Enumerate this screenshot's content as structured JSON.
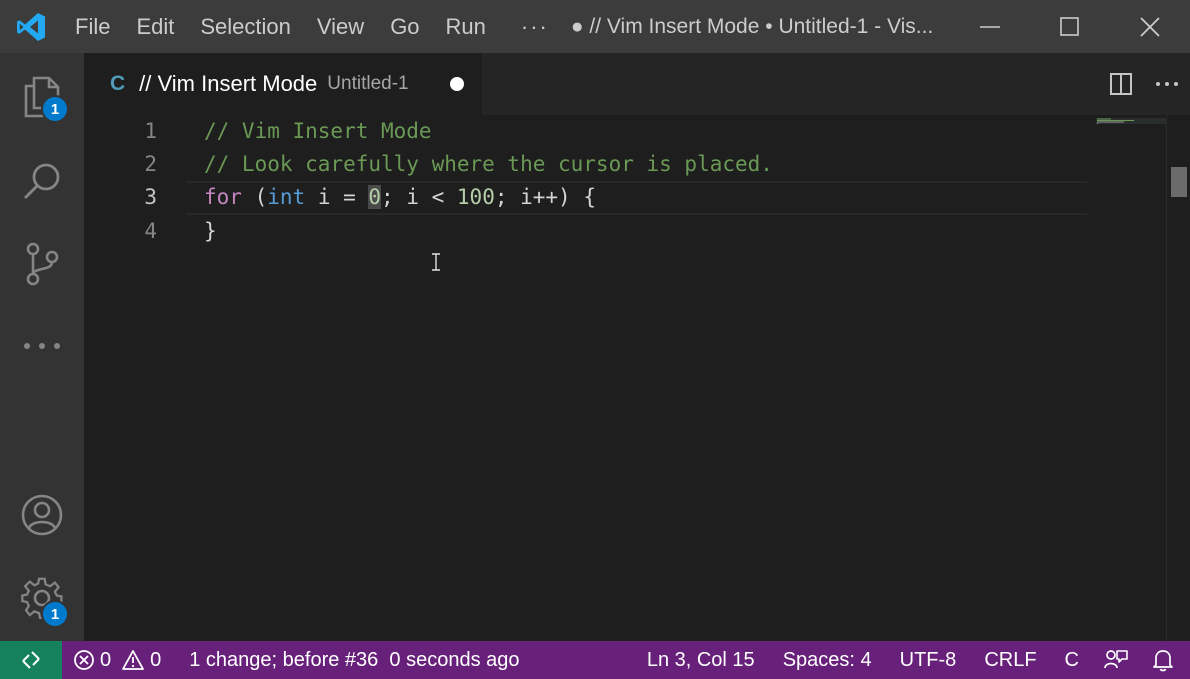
{
  "titlebar": {
    "menu": [
      "File",
      "Edit",
      "Selection",
      "View",
      "Go",
      "Run"
    ],
    "menu_more": "···",
    "window_title": "● // Vim Insert Mode • Untitled-1 - Vis..."
  },
  "activitybar": {
    "explorer_badge": "1",
    "settings_badge": "1"
  },
  "tab": {
    "lang_icon": "C",
    "name": "// Vim Insert Mode",
    "description": "Untitled-1"
  },
  "editor": {
    "line_numbers": [
      "1",
      "2",
      "3",
      "4"
    ],
    "lines": [
      "// Vim Insert Mode",
      "// Look carefully where the cursor is placed.",
      "for (int i = 0; i < 100; i++) {",
      "}"
    ],
    "line3": {
      "kw_for": "for",
      "p1": " (",
      "kw_int": "int",
      "p2": " i = ",
      "cursor_char": "0",
      "p3": "; i < ",
      "num_100": "100",
      "p4": "; i++) {"
    }
  },
  "statusbar": {
    "errors": "0",
    "warnings": "0",
    "undo_info": "1 change; before #36  0 seconds ago",
    "position": "Ln 3, Col 15",
    "spaces": "Spaces: 4",
    "encoding": "UTF-8",
    "eol": "CRLF",
    "language": "C"
  },
  "colors": {
    "statusbar_bg": "#68217a",
    "remote_bg": "#16825d",
    "badge_bg": "#007acc",
    "comment": "#6a9955",
    "keyword": "#c586c0",
    "type": "#569cd6",
    "number": "#b5cea8"
  }
}
